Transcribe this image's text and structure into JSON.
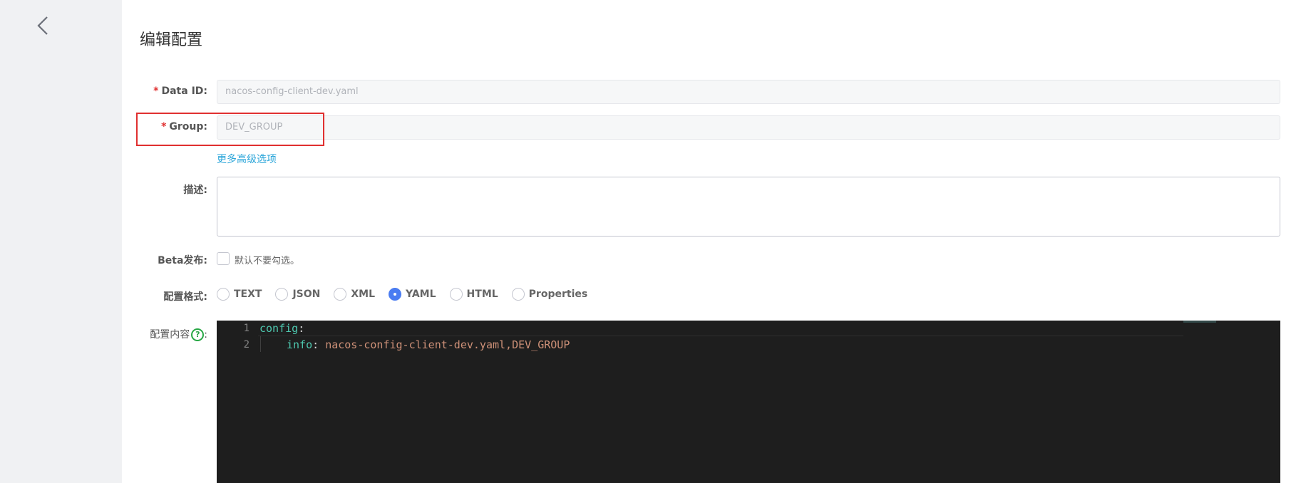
{
  "title": "编辑配置",
  "fields": {
    "data_id": {
      "required_mark": "*",
      "label": "Data ID:",
      "value": "nacos-config-client-dev.yaml"
    },
    "group": {
      "required_mark": "*",
      "label": "Group:",
      "value": "DEV_GROUP"
    },
    "advanced_link": "更多高级选项",
    "description": {
      "label": "描述:",
      "value": ""
    },
    "beta": {
      "label": "Beta发布:",
      "checkbox_text": "默认不要勾选。"
    },
    "format": {
      "label": "配置格式:",
      "options": [
        "TEXT",
        "JSON",
        "XML",
        "YAML",
        "HTML",
        "Properties"
      ],
      "selected": "YAML"
    },
    "content": {
      "label": "配置内容",
      "help_icon": "?",
      "label_suffix": ":",
      "lines": [
        {
          "num": "1",
          "key": "config",
          "sep": ":",
          "value": ""
        },
        {
          "num": "2",
          "key": "info",
          "sep": ": ",
          "value": "nacos-config-client-dev.yaml,DEV_GROUP"
        }
      ]
    }
  },
  "colors": {
    "accent": "#4a7cf1",
    "required": "#e03030",
    "link": "#2aa5d9",
    "help": "#28a745",
    "editor_bg": "#1e1e1e"
  }
}
